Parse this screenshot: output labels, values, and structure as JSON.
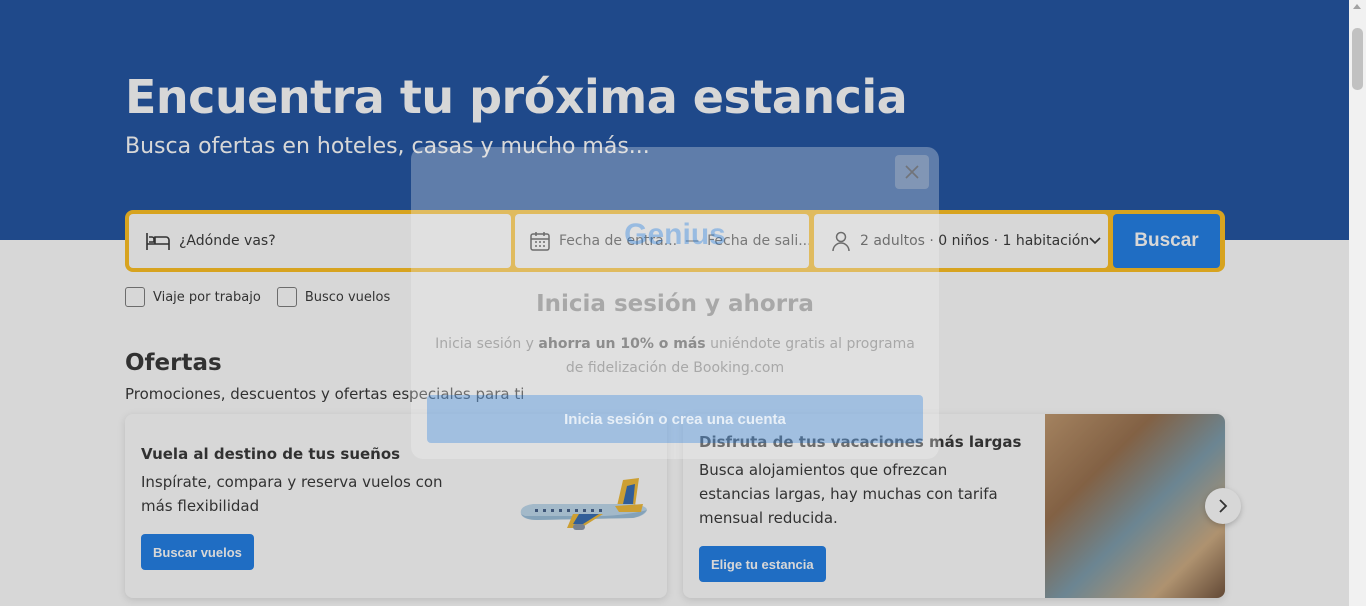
{
  "hero": {
    "title": "Encuentra tu próxima estancia",
    "subtitle": "Busca ofertas en hoteles, casas y mucho más..."
  },
  "search": {
    "destination_placeholder": "¿Adónde vas?",
    "checkin": "Fecha de entra...",
    "checkout": "Fecha de sali...",
    "guests": "2 adultos · 0 niños · 1 habitación",
    "button": "Buscar"
  },
  "options": {
    "work_trip": "Viaje por trabajo",
    "flights": "Busco vuelos"
  },
  "offers": {
    "title": "Ofertas",
    "subtitle": "Promociones, descuentos y ofertas especiales para ti",
    "cards": [
      {
        "title": "Vuela al destino de tus sueños",
        "text": "Inspírate, compara y reserva vuelos con más flexibilidad",
        "button": "Buscar vuelos"
      },
      {
        "title": "Disfruta de tus vacaciones más largas",
        "text": "Busca alojamientos que ofrezcan estancias largas, hay muchas con tarifa mensual reducida.",
        "button": "Elige tu estancia"
      }
    ]
  },
  "modal": {
    "logo": "Genius",
    "title": "Inicia sesión y ahorra",
    "text_before": "Inicia sesión y",
    "text_bold": "ahorra un 10% o más",
    "text_after": "uniéndote gratis al programa de fidelización de Booking.com",
    "button": "Inicia sesión o crea una cuenta"
  },
  "colors": {
    "brand_blue": "#003b95",
    "action_blue": "#006ce4",
    "search_border": "#ffb700"
  }
}
